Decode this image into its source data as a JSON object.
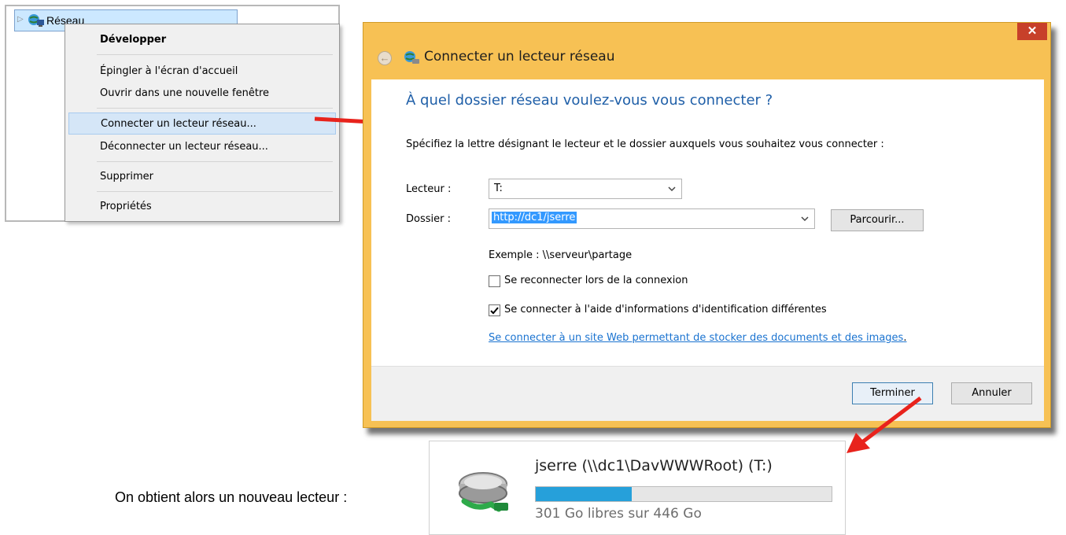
{
  "tree": {
    "item_label": "Réseau",
    "icons": {
      "expand": "chevron-right-icon",
      "network": "network-icon"
    }
  },
  "context_menu": {
    "items": [
      {
        "label": "Développer",
        "bold": true
      },
      {
        "label": "Épingler à l'écran d'accueil"
      },
      {
        "label": "Ouvrir dans une nouvelle fenêtre"
      },
      {
        "label": "Connecter un lecteur réseau...",
        "highlighted": true
      },
      {
        "label": "Déconnecter un lecteur réseau..."
      },
      {
        "label": "Supprimer"
      },
      {
        "label": "Propriétés"
      }
    ]
  },
  "dialog": {
    "title": "Connecter un lecteur réseau",
    "close_label": "✕",
    "heading": "À quel dossier réseau voulez-vous vous connecter ?",
    "instruction": "Spécifiez la lettre désignant le lecteur et le dossier auxquels vous souhaitez vous connecter :",
    "drive_label": "Lecteur :",
    "drive_value": "T:",
    "folder_label": "Dossier :",
    "folder_value": "http://dc1/jserre",
    "browse_label": "Parcourir...",
    "example": "Exemple : \\\\serveur\\partage",
    "reconnect_label": "Se reconnecter lors de la connexion",
    "reconnect_checked": false,
    "credentials_label": "Se connecter à l'aide d'informations d'identification différentes",
    "credentials_checked": true,
    "web_link": "Se connecter à un site Web permettant de stocker des documents et des images",
    "web_link_suffix": ".",
    "finish_label": "Terminer",
    "cancel_label": "Annuler"
  },
  "drive_tile": {
    "name": "jserre (\\\\dc1\\DavWWWRoot) (T:)",
    "free_text": "301 Go libres sur 446 Go",
    "used_fraction": 0.325,
    "icon": "network-drive-icon"
  },
  "caption": "On obtient alors un nouveau lecteur :",
  "colors": {
    "dialog_frame": "#f7c154",
    "heading_blue": "#1f5fa8",
    "link_blue": "#1a73d0",
    "close_red": "#c7402a",
    "arrow_red": "#e8231c",
    "bar_fill": "#26a0da"
  }
}
